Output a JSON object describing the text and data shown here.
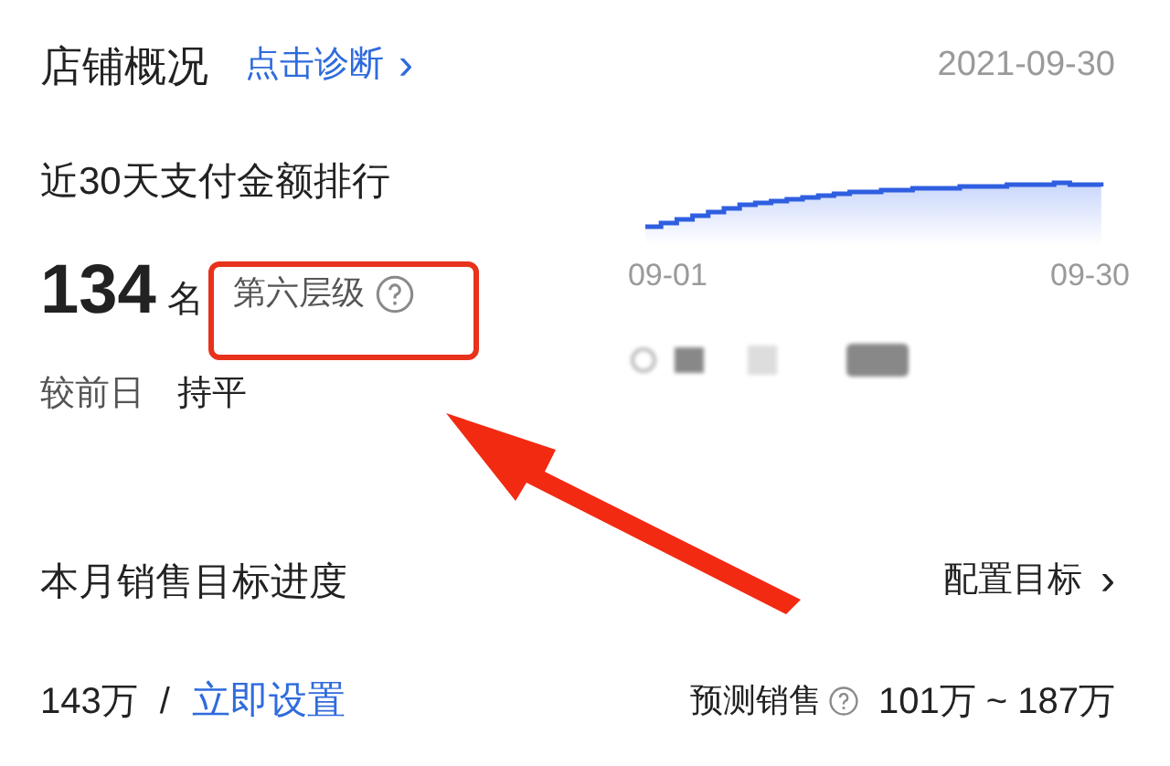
{
  "header": {
    "title": "店铺概况",
    "link": "点击诊断",
    "link_arrow": "›",
    "date": "2021-09-30"
  },
  "ranking": {
    "title": "近30天支付金额排行",
    "rank": "134",
    "unit": "名",
    "tier": "第六层级",
    "compare_label": "较前日",
    "compare_value": "持平"
  },
  "trend": {
    "x_start": "09-01",
    "x_end": "09-30"
  },
  "target": {
    "title": "本月销售目标进度",
    "action": "配置目标",
    "amount": "143万",
    "separator": "/",
    "set_link": "立即设置",
    "forecast_label": "预测销售",
    "forecast_value": "101万 ~ 187万"
  }
}
